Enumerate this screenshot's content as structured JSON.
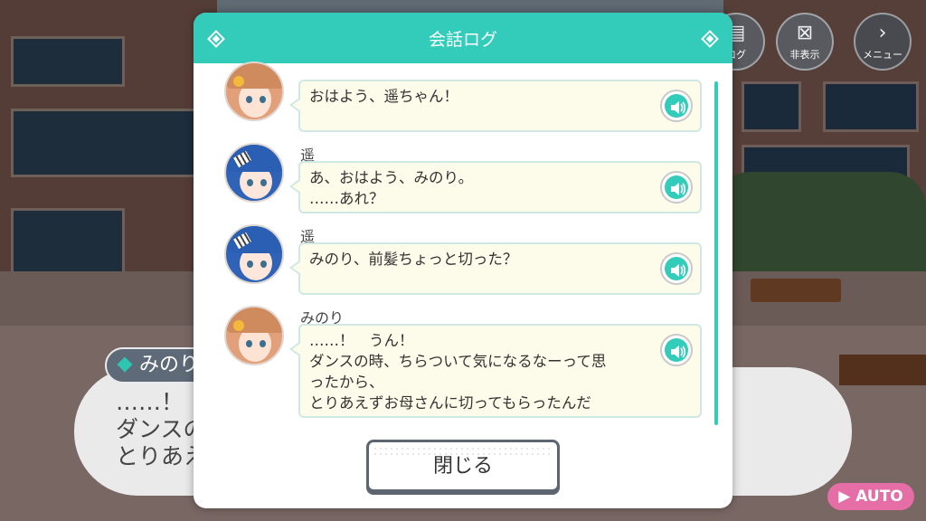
{
  "hud": {
    "log_label": "ログ",
    "hide_label": "非表示",
    "menu_label": "メニュー"
  },
  "message_box": {
    "speaker": "みのり",
    "lines": [
      "……！",
      "ダンスの",
      "とりあえ"
    ]
  },
  "auto_label": "AUTO",
  "log_dialog": {
    "title": "会話ログ",
    "close_label": "閉じる",
    "entries": [
      {
        "speaker": "",
        "character": "minori",
        "text": "おはよう、遥ちゃん！"
      },
      {
        "speaker": "遥",
        "character": "haruka",
        "text": "あ、おはよう、みのり。\n……あれ？"
      },
      {
        "speaker": "遥",
        "character": "haruka",
        "text": "みのり、前髪ちょっと切った？"
      },
      {
        "speaker": "みのり",
        "character": "minori",
        "text": "……！　うん！\nダンスの時、ちらついて気になるなーって思\nったから、\nとりあえずお母さんに切ってもらったんだ"
      }
    ]
  },
  "colors": {
    "accent": "#33ccbb",
    "bubble": "#fdfbe9",
    "auto": "#e46ea5"
  }
}
